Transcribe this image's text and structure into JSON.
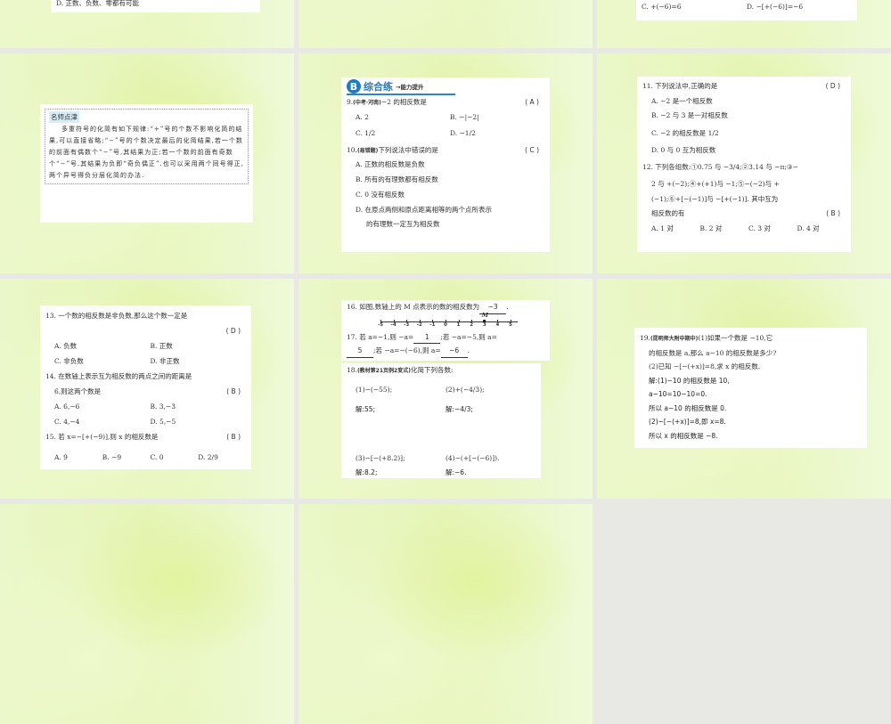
{
  "slides": [
    {
      "id": "r1c1",
      "lines": [
        "D. 正数、负数、零都有可能"
      ]
    },
    {
      "id": "r1c2"
    },
    {
      "id": "r1c3",
      "c": "C. +(−6)=6",
      "d": "D. −[+(−6)]=−6"
    },
    {
      "id": "r2c1",
      "tip_title": "名师点津",
      "tip_text": "多重符号的化简有如下规律:“+”号的个数不影响化简的结果,可以直接省略;“−”号的个数决定最后的化简结果,若一个数的前面有偶数个“−”号,其结果为正;若一个数的前面有奇数个“−”号,其结果为负即“奇负偶正”.也可以采用两个同号得正,两个异号得负分层化简的办法."
    },
    {
      "id": "r2c2",
      "badge": "B",
      "section": "综合练",
      "subsection": "→能力提升",
      "q9": {
        "stem": "9.",
        "tag": "(中考·河南)",
        "text": "−2 的相反数是",
        "answer": "( A )",
        "a": "A. 2",
        "b": "B. −|−2|",
        "c": "C. 1/2",
        "d": "D. −1/2"
      },
      "q10": {
        "stem": "10.",
        "tag": "(易错题)",
        "text": "下列说法中错误的是",
        "answer": "( C )",
        "a": "A. 正数的相反数是负数",
        "b": "B. 所有的有理数都有相反数",
        "c": "C. 0 没有相反数",
        "d1": "D. 在原点两侧和原点距离相等的两个点所表示",
        "d2": "的有理数一定互为相反数"
      }
    },
    {
      "id": "r2c3",
      "q11": {
        "text": "11. 下列说法中,正确的是",
        "answer": "( D )",
        "a": "A. −2 是一个相反数",
        "b": "B. −2 与 3 是一对相反数",
        "c": "C. −2 的相反数是 1/2",
        "d": "D. 0 与 0 互为相反数"
      },
      "q12": {
        "l1": "12. 下列各组数:①0.75 与 −3/4;②3.14 与 −π;③−",
        "l2": "2 与 +(−2);④+(+1)与 −1;⑤−(−2)与 +",
        "l3": "(−1);⑥+[−(−1)]与 −[+(−1)]. 其中互为",
        "l4": "相反数的有",
        "answer": "( B )",
        "a": "A. 1 对",
        "b": "B. 2 对",
        "c": "C. 3 对",
        "d": "D. 4 对"
      }
    },
    {
      "id": "r3c1",
      "q13": {
        "text": "13. 一个数的相反数是非负数,那么这个数一定是",
        "answer": "( D )",
        "a": "A. 负数",
        "b": "B. 正数",
        "c": "C. 非负数",
        "d": "D. 非正数"
      },
      "q14": {
        "l1": "14. 在数轴上表示互为相反数的两点之间的距离是",
        "l2": "6,则这两个数是",
        "answer": "( B )",
        "a": "A. 6,−6",
        "b": "B. 3,−3",
        "c": "C. 4,−4",
        "d": "D. 5,−5"
      },
      "q15": {
        "text": "15. 若 x=−[+(−9)],则 x 的相反数是",
        "answer": "( B )",
        "a": "A. 9",
        "b": "B. −9",
        "c": "C. 0",
        "d": "D. 2/9"
      }
    },
    {
      "id": "r3c2",
      "q16": {
        "text": "16. 如图,数轴上的 M 点表示的数的相反数为",
        "blank": "−3",
        "end": ".",
        "point_label": "M",
        "ticks": [
          "-5",
          "-4",
          "-3",
          "-2",
          "-1",
          "0",
          "1",
          "2",
          "3",
          "4",
          "5"
        ],
        "point_value": 3
      },
      "q17": {
        "p1": "17. 若 a=−1,则 −a=",
        "b1": "1",
        "p2": ";若 −a=−5,则 a=",
        "b2": "5",
        "p3": ";若 −a=−(−6),则 a=",
        "b3": "−6",
        "end": "."
      },
      "q18": {
        "stem": "18.",
        "tag": "(教材第21页例2变式)",
        "text": "化简下列各数:",
        "p1": "(1)−(−55);",
        "p2": "(2)+(−4/3);",
        "s1": "解:55;",
        "s2": "解:−4/3;",
        "p3": "(3)−[−(+8.2)];",
        "p4": "(4)−(+[−(−6)]).",
        "s3": "解:8.2;",
        "s4": "解:−6."
      }
    },
    {
      "id": "r3c3",
      "q19": {
        "stem": "19.",
        "tag": "(昆明师大附中期中)",
        "l1": "(1)如果一个数是 −10,它",
        "l2": "的相反数是 a,那么 a−10 的相反数是多少?",
        "l3": "(2)已知 −[−(+x)]=8,求 x 的相反数.",
        "s1": "解:(1)−10 的相反数是 10,",
        "s2": "a−10=10−10=0.",
        "s3": "所以 a−10 的相反数是 0.",
        "s4": "(2)−[−(+x)]=8,即 x=8.",
        "s5": "所以 x 的相反数是 −8."
      }
    },
    {
      "id": "r4c1"
    },
    {
      "id": "r4c2"
    }
  ]
}
